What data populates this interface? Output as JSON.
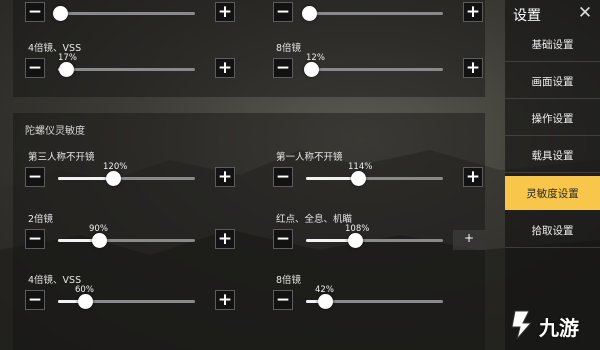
{
  "top_section": {
    "sliders": [
      {
        "label": "",
        "value": 4
      },
      {
        "label": "",
        "value": 7
      },
      {
        "label": "4倍镜、VSS",
        "percent": "17%",
        "value": 17
      },
      {
        "label": "8倍镜",
        "percent": "12%",
        "value": 12
      }
    ]
  },
  "gyro_section": {
    "title": "陀螺仪灵敏度",
    "sliders": [
      {
        "label": "第三人称不开镜",
        "percent": "120%",
        "value": 120
      },
      {
        "label": "第一人称不开镜",
        "percent": "114%",
        "value": 114
      },
      {
        "label": "2倍镜",
        "percent": "90%",
        "value": 90
      },
      {
        "label": "红点、全息、机瞄",
        "percent": "108%",
        "value": 108
      },
      {
        "label": "4倍镜、VSS",
        "percent": "60%",
        "value": 60
      },
      {
        "label": "8倍镜",
        "percent": "42%",
        "value": 42
      }
    ]
  },
  "slider_max": 300,
  "buttons": {
    "minus": "−",
    "plus": "+"
  },
  "menu": {
    "title": "设置",
    "close": "✕",
    "items": [
      {
        "label": "基础设置",
        "active": false
      },
      {
        "label": "画面设置",
        "active": false
      },
      {
        "label": "操作设置",
        "active": false
      },
      {
        "label": "载具设置",
        "active": false
      },
      {
        "label": "灵敏度设置",
        "active": true
      },
      {
        "label": "拾取设置",
        "active": false
      }
    ]
  },
  "watermark": {
    "text": "九游"
  },
  "colors": {
    "accent": "#f7c64a",
    "panel": "#141414"
  }
}
